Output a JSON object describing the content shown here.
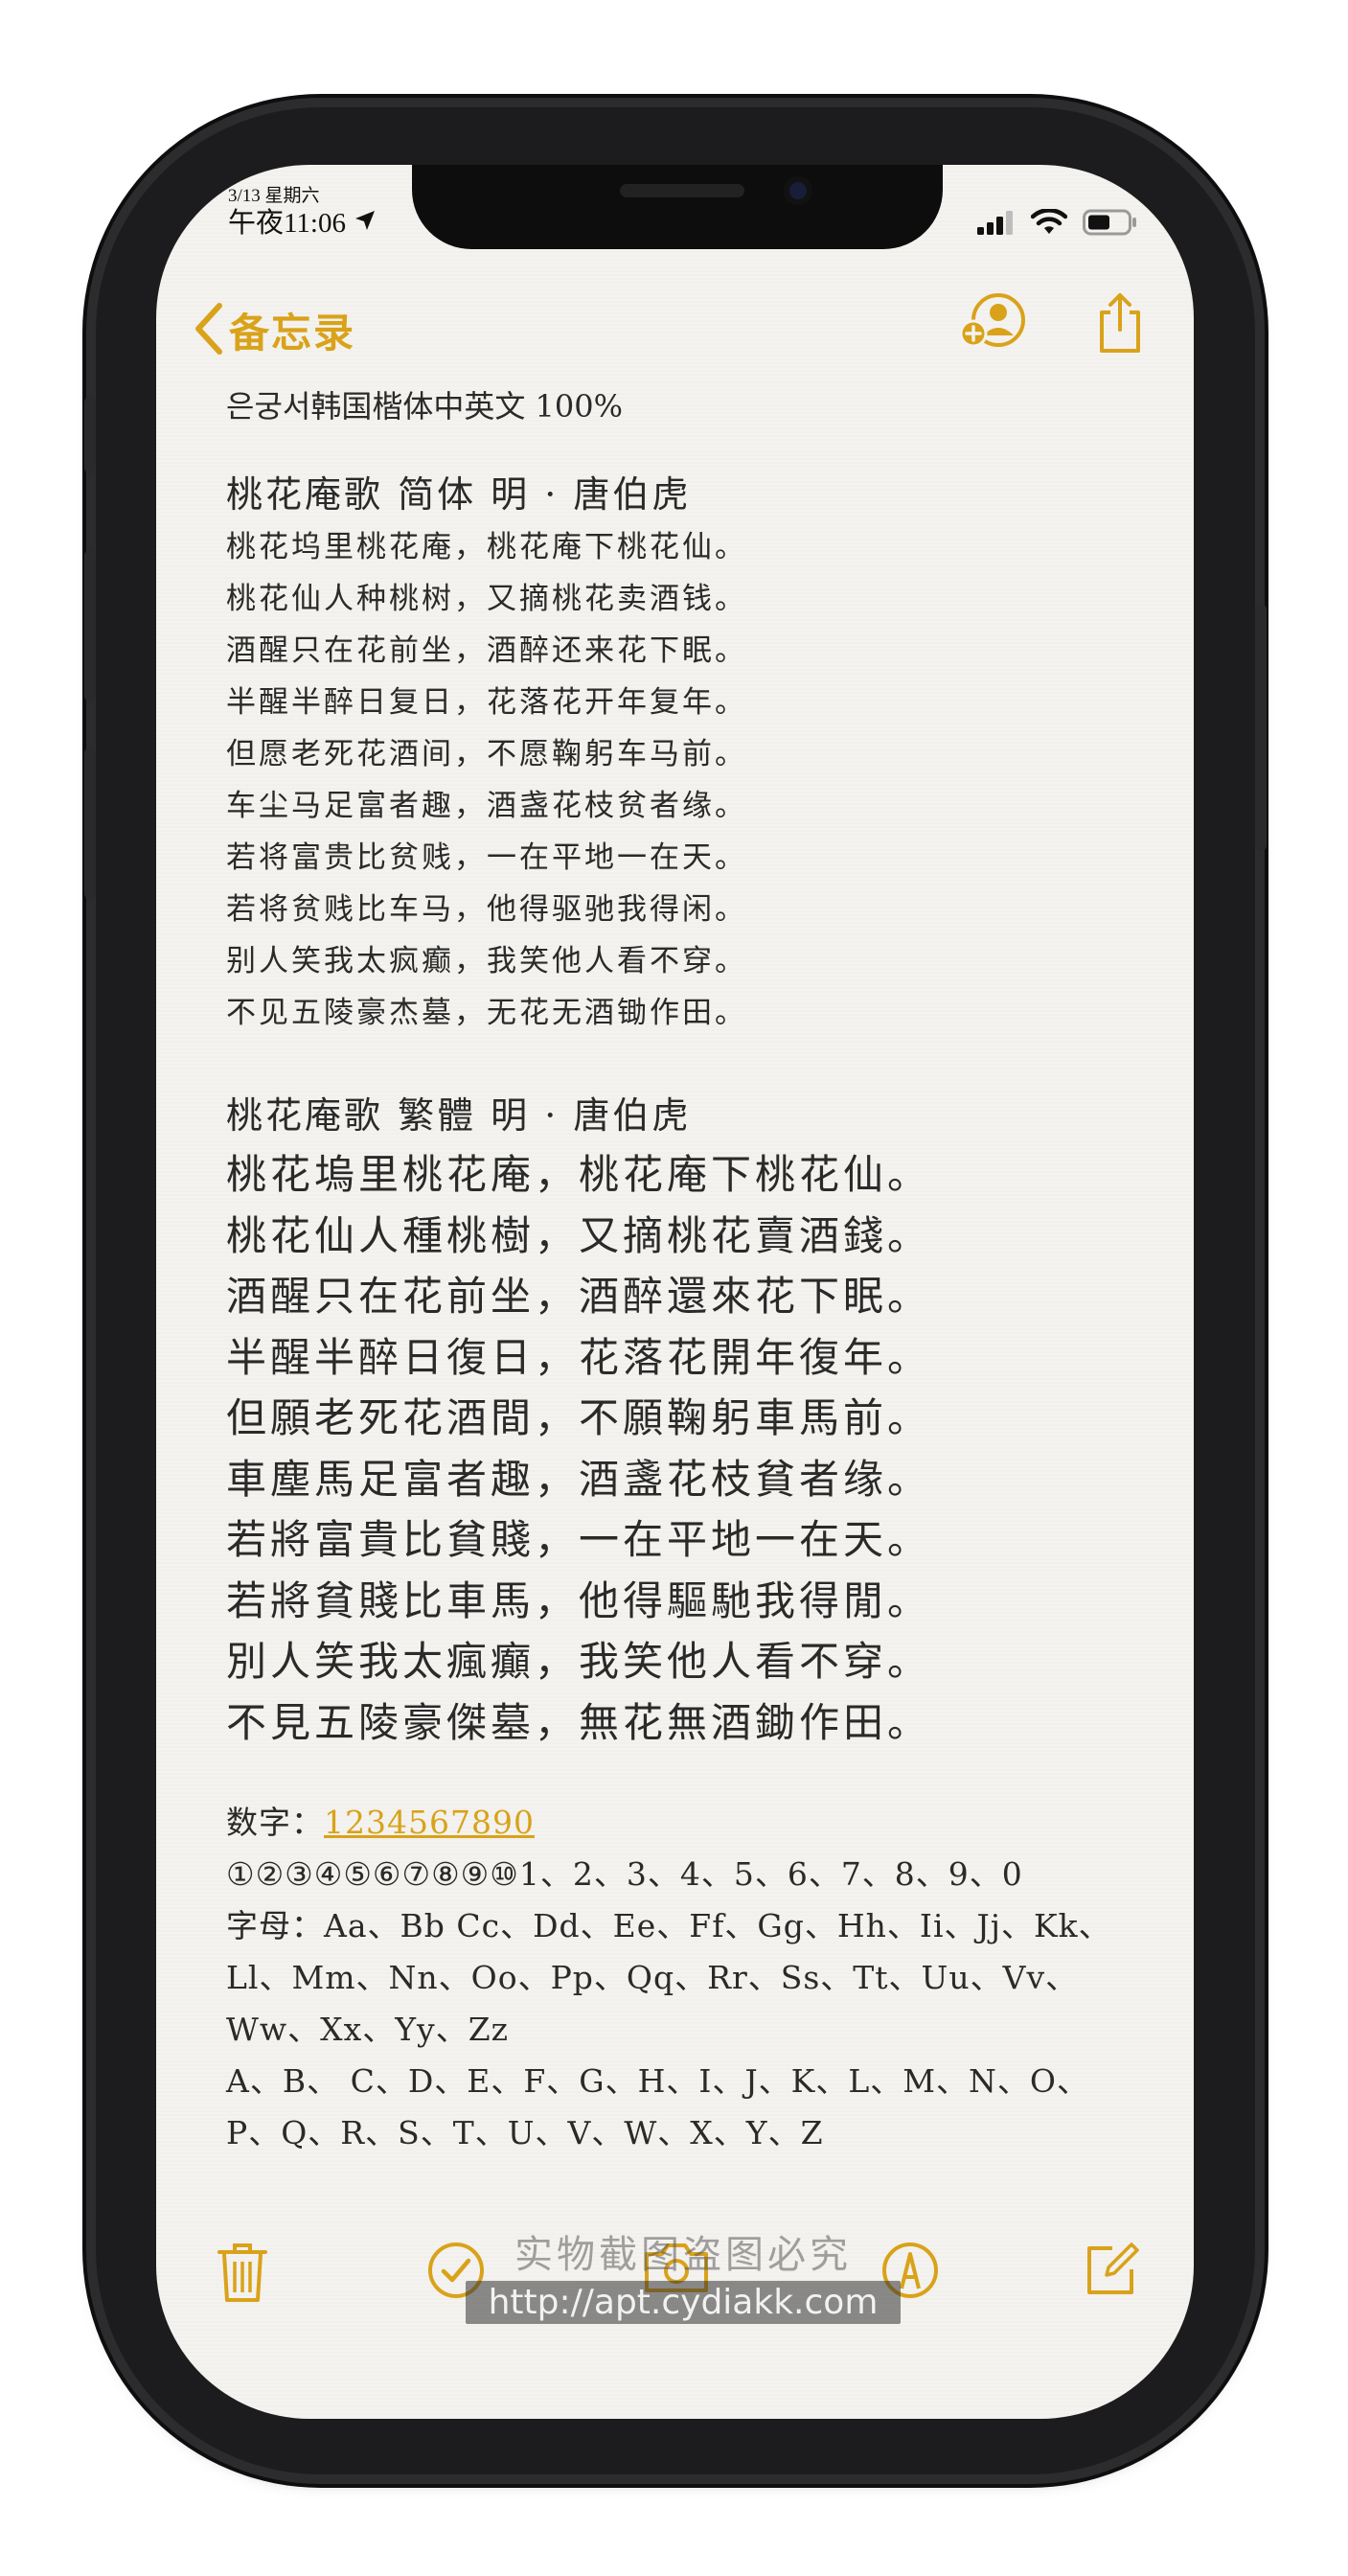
{
  "status_bar": {
    "date": "3/13 星期六",
    "time": "午夜11:06",
    "icons": [
      "location-arrow-icon",
      "cellular-signal-icon",
      "wifi-icon",
      "battery-icon"
    ]
  },
  "nav": {
    "back_label": "备忘录",
    "icons": [
      "chevron-left-icon",
      "add-person-icon",
      "share-icon"
    ]
  },
  "note": {
    "header": "은궁서韩国楷体中英文 100%",
    "simplified_title": "桃花庵歌 简体  明 · 唐伯虎",
    "simplified_lines": [
      "桃花坞里桃花庵，桃花庵下桃花仙。",
      "桃花仙人种桃树，又摘桃花卖酒钱。",
      "酒醒只在花前坐，酒醉还来花下眠。",
      "半醒半醉日复日，花落花开年复年。",
      "但愿老死花酒间，不愿鞠躬车马前。",
      "车尘马足富者趣，酒盏花枝贫者缘。",
      "若将富贵比贫贱，一在平地一在天。",
      "若将贫贱比车马，他得驱驰我得闲。",
      "别人笑我太疯癫，我笑他人看不穿。",
      "不见五陵豪杰墓，无花无酒锄作田。"
    ],
    "traditional_title": "桃花庵歌 繁體    明 · 唐伯虎",
    "traditional_lines": [
      "桃花塢里桃花庵，桃花庵下桃花仙。",
      "桃花仙人種桃樹，又摘桃花賣酒錢。",
      "酒醒只在花前坐，酒醉還來花下眠。",
      "半醒半醉日復日，花落花開年復年。",
      "但願老死花酒間，不願鞠躬車馬前。",
      "車塵馬足富者趣，酒盞花枝貧者缘。",
      "若將富貴比貧賤，一在平地一在天。",
      "若將貧賤比車馬，他得驅馳我得閒。",
      "別人笑我太瘋癲，我笑他人看不穿。",
      "不見五陵豪傑墓，無花無酒鋤作田。"
    ],
    "digits_label": "数字：",
    "digits_link": "1234567890",
    "numbers_line": "①②③④⑤⑥⑦⑧⑨⑩1、2、3、4、5、6、7、8、9、0",
    "letters_line1": "字母：Aa、Bb Cc、Dd、Ee、Ff、Gg、Hh、Ii、Jj、Kk、",
    "letters_line2": "Ll、Mm、Nn、Oo、Pp、Qq、Rr、Ss、Tt、Uu、Vv、",
    "letters_line3": "Ww、Xx、Yy、Zz",
    "upper_line1": "A、B、 C、D、E、F、G、H、I、J、K、L、M、N、O、",
    "upper_line2": "P、Q、R、S、T、U、V、W、X、Y、Z"
  },
  "toolbar": {
    "icons": [
      "trash-icon",
      "checklist-icon",
      "camera-icon",
      "markup-pen-icon",
      "compose-icon"
    ]
  },
  "watermark": {
    "line1": "实物截图盗图必究",
    "line2": "http://apt.cydiakk.com"
  },
  "colors": {
    "accent": "#d9a21a",
    "paper": "#f4f3ef",
    "text": "#2a2a2a",
    "bezel": "#1c1c1e"
  }
}
